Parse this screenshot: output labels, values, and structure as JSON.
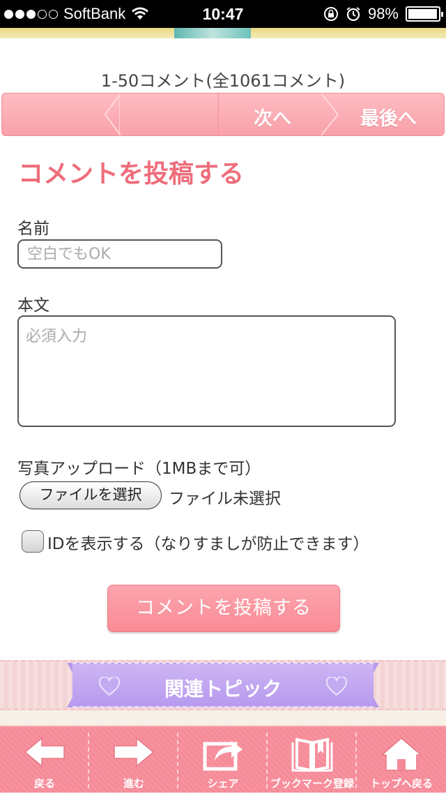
{
  "status_bar": {
    "carrier": "SoftBank",
    "time": "10:47",
    "battery": "98%",
    "battery_level": 0.98,
    "signal_bars_filled": 3,
    "signal_bars_total": 5
  },
  "pagination": {
    "count_text": "1-50コメント(全1061コメント)",
    "next_label": "次へ",
    "last_label": "最後へ"
  },
  "form": {
    "title": "コメントを投稿する",
    "name_label": "名前",
    "name_placeholder": "空白でもOK",
    "body_label": "本文",
    "body_placeholder": "必須入力",
    "upload_label": "写真アップロード（1MBまで可）",
    "file_button": "ファイルを選択",
    "file_status": "ファイル未選択",
    "show_id_label": "IDを表示する（なりすましが防止できます）",
    "show_id_checked": false,
    "submit_label": "コメントを投稿する"
  },
  "related": {
    "title": "関連トピック"
  },
  "toolbar": {
    "items": [
      {
        "label": "戻る",
        "icon": "arrow-left-icon"
      },
      {
        "label": "進む",
        "icon": "arrow-right-icon"
      },
      {
        "label": "シェア",
        "icon": "share-icon"
      },
      {
        "label": "ブックマーク登録",
        "icon": "book-icon"
      },
      {
        "label": "トップへ戻る",
        "icon": "home-icon"
      }
    ]
  },
  "colors": {
    "accent_pink": "#ee6d7b",
    "button_pink": "#f98b96",
    "ribbon_purple": "#b79aee"
  }
}
